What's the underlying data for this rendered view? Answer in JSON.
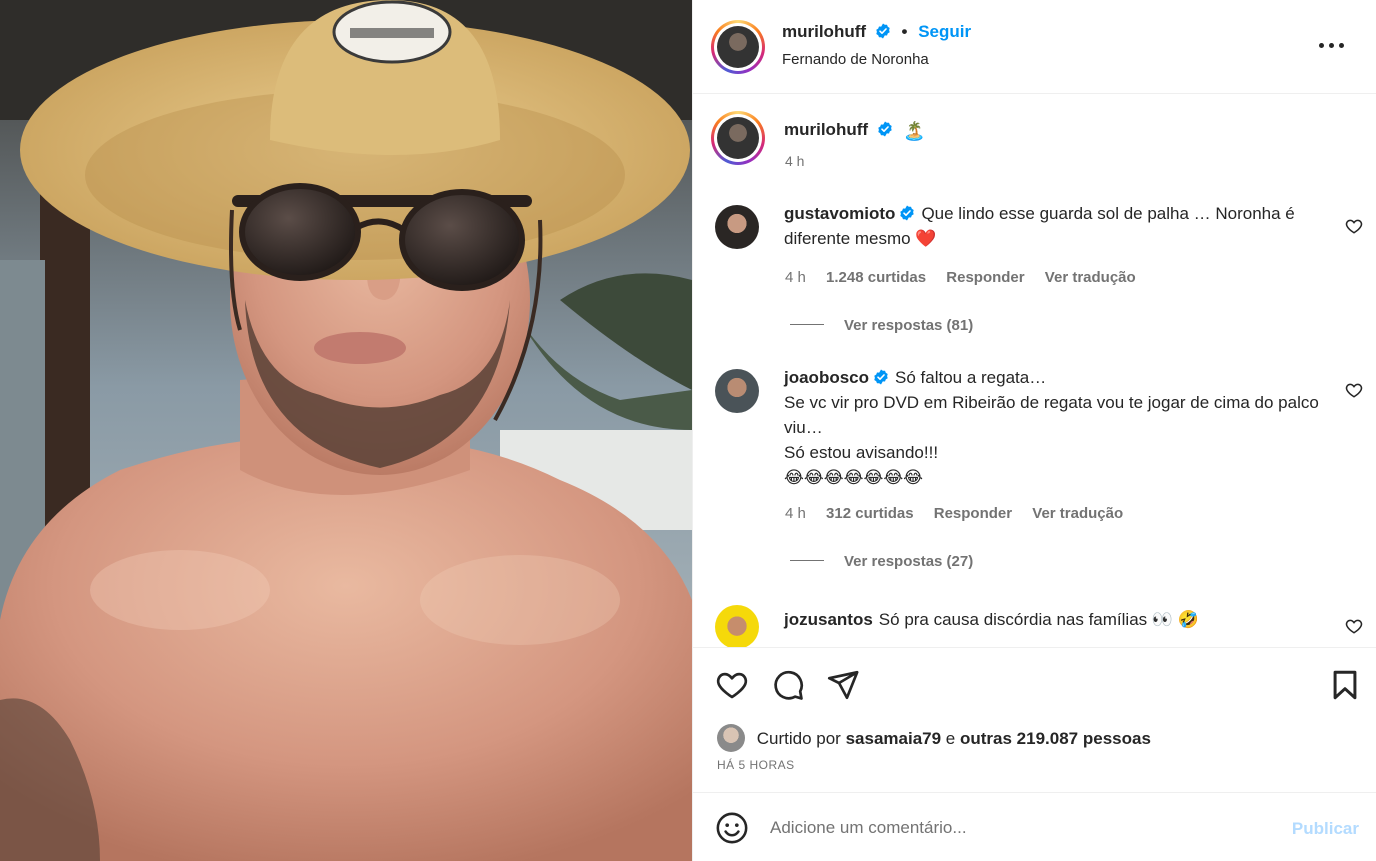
{
  "header": {
    "username": "murilohuff",
    "separator": "•",
    "follow_label": "Seguir",
    "location": "Fernando de Noronha"
  },
  "caption": {
    "username": "murilohuff",
    "text": "🏝️",
    "time": "4 h"
  },
  "comments": [
    {
      "username": "gustavomioto",
      "verified": true,
      "text": "Que lindo esse guarda sol de palha … Noronha é diferente mesmo ❤️",
      "time": "4 h",
      "likes": "1.248 curtidas",
      "reply_label": "Responder",
      "translate_label": "Ver tradução",
      "view_replies": "Ver respostas (81)"
    },
    {
      "username": "joaobosco",
      "verified": true,
      "text_line1": "Só faltou a regata…",
      "text_line2": "Se vc vir pro DVD em Ribeirão de regata vou te jogar de cima do palco viu…",
      "text_line3": "Só estou avisando!!!",
      "text_line4": "😂😂😂😂😂😂😂",
      "time": "4 h",
      "likes": "312 curtidas",
      "reply_label": "Responder",
      "translate_label": "Ver tradução",
      "view_replies": "Ver respostas (27)"
    },
    {
      "username": "jozusantos",
      "verified": false,
      "text": "Só pra causa discórdia nas famílias 👀 🤣"
    }
  ],
  "likes": {
    "prefix": "Curtido por",
    "user": "sasamaia79",
    "connector": "e",
    "others": "outras 219.087 pessoas"
  },
  "posted_ago": "HÁ 5 HORAS",
  "add_comment": {
    "placeholder": "Adicione um comentário...",
    "publish_label": "Publicar"
  },
  "icons": {
    "more": "more-horizontal-icon",
    "like": "heart-icon",
    "comment": "comment-icon",
    "share": "send-icon",
    "save": "bookmark-icon",
    "emoji": "emoji-icon",
    "verified": "verified-badge-icon"
  },
  "colors": {
    "accent_blue": "#0095f6",
    "publish_disabled": "#b3dbff",
    "secondary_text": "#737373",
    "heart_red": "#ed4956"
  }
}
